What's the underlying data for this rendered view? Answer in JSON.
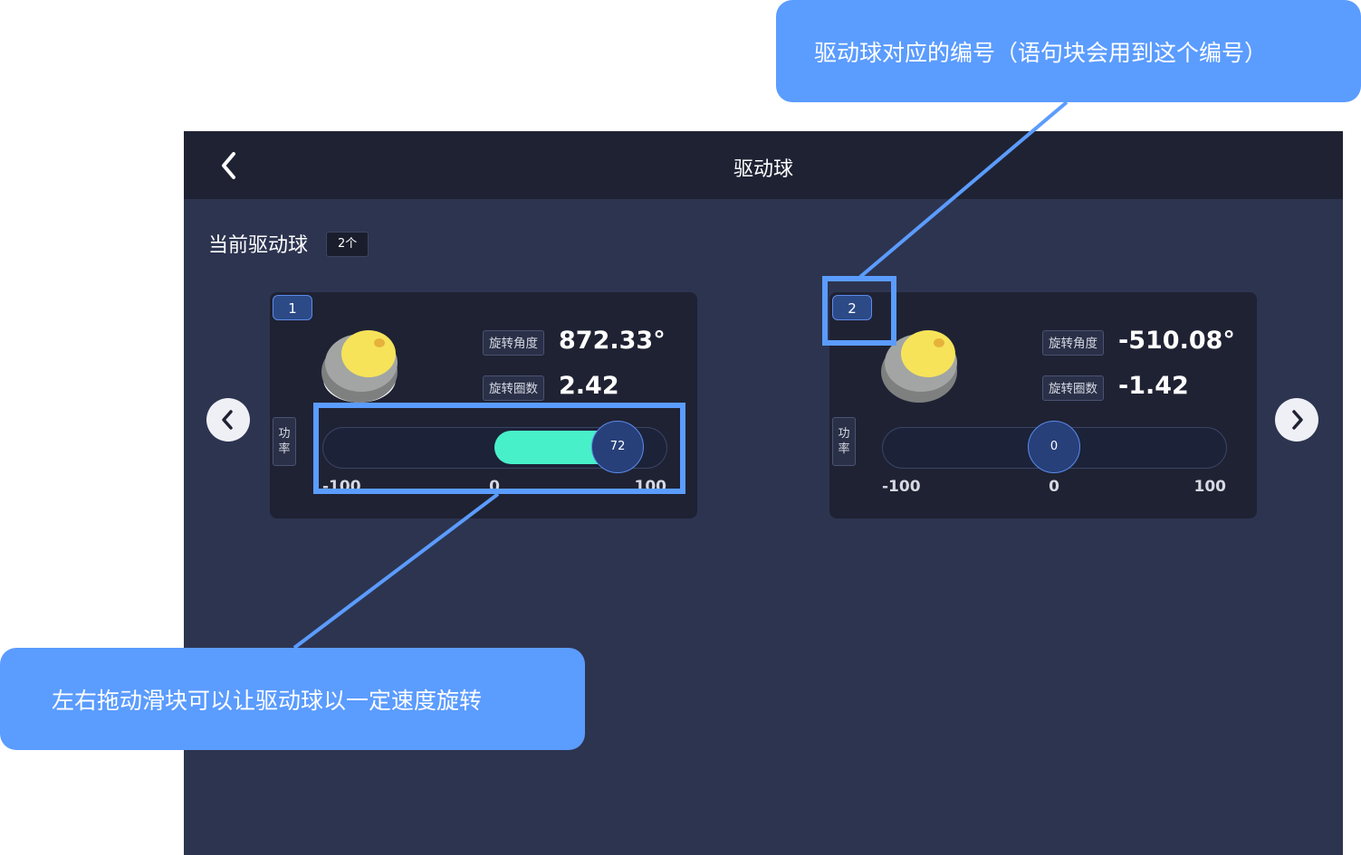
{
  "header": {
    "title": "驱动球",
    "back_icon": "chevron-left-icon"
  },
  "section": {
    "label": "当前驱动球",
    "count_badge": "2个"
  },
  "nav": {
    "prev_icon": "chevron-left-icon",
    "next_icon": "chevron-right-icon"
  },
  "balls": [
    {
      "index": "1",
      "angle_label": "旋转角度",
      "angle_value": "872.33°",
      "turns_label": "旋转圈数",
      "turns_value": "2.42",
      "power_label_1": "功",
      "power_label_2": "率",
      "slider": {
        "value": 72,
        "value_text": "72",
        "min": -100,
        "max": 100,
        "min_label": "-100",
        "mid_label": "0",
        "max_label": "100"
      }
    },
    {
      "index": "2",
      "angle_label": "旋转角度",
      "angle_value": "-510.08°",
      "turns_label": "旋转圈数",
      "turns_value": "-1.42",
      "power_label_1": "功",
      "power_label_2": "率",
      "slider": {
        "value": 0,
        "value_text": "0",
        "min": -100,
        "max": 100,
        "min_label": "-100",
        "mid_label": "0",
        "max_label": "100"
      }
    }
  ],
  "annotations": {
    "top_callout": "驱动球对应的编号（语句块会用到这个编号）",
    "bottom_callout": "左右拖动滑块可以让驱动球以一定速度旋转"
  },
  "colors": {
    "page_bg": "#2d3450",
    "topbar_bg": "#1f2233",
    "card_bg": "#1f2233",
    "slider_fill": "#48f0c9",
    "accent_blue": "#5b9cff",
    "ball_yellow": "#f6e35a",
    "ball_gray": "#8a8d8c"
  }
}
